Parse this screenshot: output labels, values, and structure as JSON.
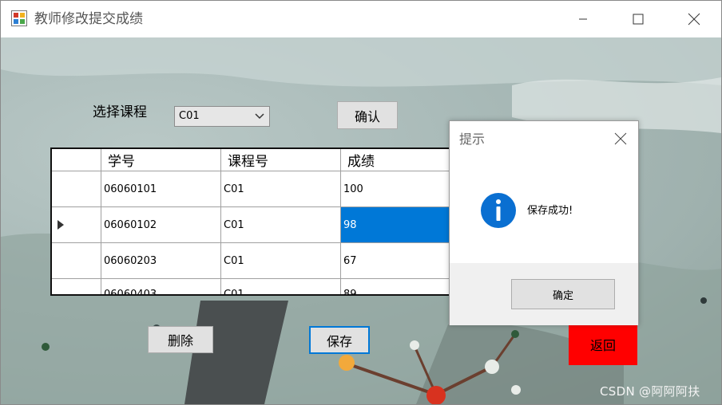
{
  "window": {
    "title": "教师修改提交成绩"
  },
  "form": {
    "course_label": "选择课程",
    "course_selected": "C01",
    "confirm_label": "确认",
    "delete_label": "删除",
    "save_label": "保存",
    "back_label": "返回"
  },
  "grid": {
    "columns": [
      "学号",
      "课程号",
      "成绩"
    ],
    "rows": [
      {
        "student_id": "06060101",
        "course_id": "C01",
        "score": "100"
      },
      {
        "student_id": "06060102",
        "course_id": "C01",
        "score": "98"
      },
      {
        "student_id": "06060203",
        "course_id": "C01",
        "score": "67"
      },
      {
        "student_id": "06060403",
        "course_id": "C01",
        "score": "89"
      }
    ],
    "current_row_index": 1
  },
  "dialog": {
    "title": "提示",
    "message": "保存成功!",
    "ok_label": "确定",
    "icon": "info-icon"
  },
  "watermark": "CSDN @阿阿阿扶",
  "colors": {
    "selection": "#0078d7",
    "back_button": "#ff0000",
    "info_icon": "#0a6fd1"
  }
}
